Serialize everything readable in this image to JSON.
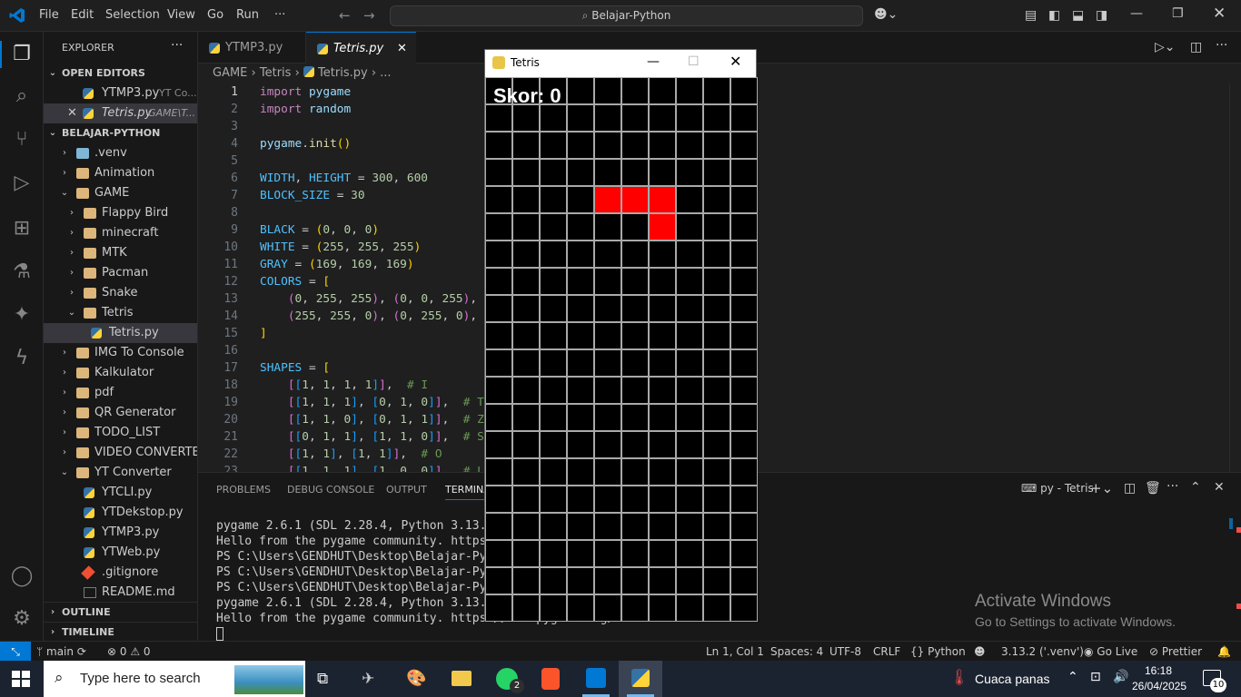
{
  "app": {
    "title": "Belajar-Python",
    "menu": [
      "File",
      "Edit",
      "Selection",
      "View",
      "Go",
      "Run",
      "···"
    ]
  },
  "explorer": {
    "title": "EXPLORER",
    "open_editors_label": "OPEN EDITORS",
    "open_editors": [
      {
        "name": "YTMP3.py",
        "desc": "YT Co..."
      },
      {
        "name": "Tetris.py",
        "desc": "GAME\\T..."
      }
    ],
    "project_label": "BELAJAR-PYTHON",
    "tree": [
      {
        "label": ".venv",
        "depth": 1,
        "type": "venv",
        "open": false
      },
      {
        "label": "Animation",
        "depth": 1,
        "type": "folder",
        "open": false
      },
      {
        "label": "GAME",
        "depth": 1,
        "type": "folder",
        "open": true
      },
      {
        "label": "Flappy Bird",
        "depth": 2,
        "type": "folder",
        "open": false
      },
      {
        "label": "minecraft",
        "depth": 2,
        "type": "folder",
        "open": false
      },
      {
        "label": "MTK",
        "depth": 2,
        "type": "folder",
        "open": false
      },
      {
        "label": "Pacman",
        "depth": 2,
        "type": "folder",
        "open": false
      },
      {
        "label": "Snake",
        "depth": 2,
        "type": "folder",
        "open": false
      },
      {
        "label": "Tetris",
        "depth": 2,
        "type": "folder",
        "open": true
      },
      {
        "label": "Tetris.py",
        "depth": 3,
        "type": "py",
        "selected": true
      },
      {
        "label": "IMG To Console",
        "depth": 1,
        "type": "folder",
        "open": false
      },
      {
        "label": "Kalkulator",
        "depth": 1,
        "type": "folder",
        "open": false
      },
      {
        "label": "pdf",
        "depth": 1,
        "type": "folder",
        "open": false
      },
      {
        "label": "QR Generator",
        "depth": 1,
        "type": "folder",
        "open": false
      },
      {
        "label": "TODO_LIST",
        "depth": 1,
        "type": "folder",
        "open": false
      },
      {
        "label": "VIDEO CONVERTER",
        "depth": 1,
        "type": "folder",
        "open": false
      },
      {
        "label": "YT Converter",
        "depth": 1,
        "type": "folder",
        "open": true
      },
      {
        "label": "YTCLI.py",
        "depth": 2,
        "type": "py"
      },
      {
        "label": "YTDekstop.py",
        "depth": 2,
        "type": "py"
      },
      {
        "label": "YTMP3.py",
        "depth": 2,
        "type": "py"
      },
      {
        "label": "YTWeb.py",
        "depth": 2,
        "type": "py"
      },
      {
        "label": ".gitignore",
        "depth": 2,
        "type": "git"
      },
      {
        "label": "README.md",
        "depth": 2,
        "type": "md"
      }
    ],
    "outline_label": "OUTLINE",
    "timeline_label": "TIMELINE"
  },
  "tabs": [
    {
      "label": "YTMP3.py",
      "active": false
    },
    {
      "label": "Tetris.py",
      "active": true
    }
  ],
  "breadcrumb": [
    "GAME",
    "Tetris",
    "Tetris.py",
    "..."
  ],
  "panel": {
    "tabs": [
      "PROBLEMS",
      "DEBUG CONSOLE",
      "OUTPUT",
      "TERMINAL"
    ],
    "terminal_name": "py - Tetris",
    "lines": [
      "pygame 2.6.1 (SDL 2.28.4, Python 3.13.2)",
      "Hello from the pygame community. https://www.pygame.org/contribute.html",
      "PS C:\\Users\\GENDHUT\\Desktop\\Belajar-Python>",
      "PS C:\\Users\\GENDHUT\\Desktop\\Belajar-Python>",
      "PS C:\\Users\\GENDHUT\\Desktop\\Belajar-Python>",
      "pygame 2.6.1 (SDL 2.28.4, Python 3.13.2)",
      "Hello from the pygame community. https://www.pygame.org/contribute.html"
    ]
  },
  "statusbar": {
    "branch": "main",
    "errors": "0",
    "warnings": "0",
    "position": "Ln 1, Col 1",
    "spaces": "Spaces: 4",
    "encoding": "UTF-8",
    "eol": "CRLF",
    "language": "Python",
    "interpreter": "3.13.2 ('.venv')",
    "golive": "Go Live",
    "prettier": "Prettier"
  },
  "tetris": {
    "window_title": "Tetris",
    "score_label": "Skor: 0",
    "cols": 10,
    "rows": 20,
    "cell_color": "#000000",
    "grid_color": "#a9a9a9",
    "piece_color": "#ff0000",
    "filled_cells": [
      [
        4,
        4
      ],
      [
        5,
        4
      ],
      [
        6,
        4
      ],
      [
        6,
        5
      ]
    ]
  },
  "watermark": {
    "title": "Activate Windows",
    "subtitle": "Go to Settings to activate Windows."
  },
  "taskbar": {
    "search_placeholder": "Type here to search",
    "weather": "Cuaca panas",
    "time": "16:18",
    "date": "26/04/2025",
    "notifications": "10",
    "whatsapp_badge": "2"
  }
}
